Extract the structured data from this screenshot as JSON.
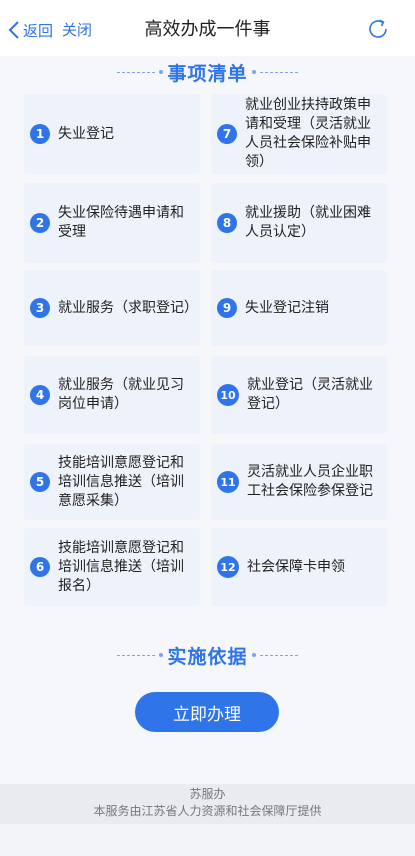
{
  "navbar": {
    "back_label": "返回",
    "close_label": "关闭",
    "title": "高效办成一件事"
  },
  "sections": {
    "items_title": "事项清单",
    "basis_title": "实施依据"
  },
  "items": [
    {
      "num": "1",
      "label": "失业登记"
    },
    {
      "num": "2",
      "label": "失业保险待遇申请和受理"
    },
    {
      "num": "3",
      "label": "就业服务（求职登记）"
    },
    {
      "num": "4",
      "label": "就业服务（就业见习岗位申请）"
    },
    {
      "num": "5",
      "label": "技能培训意愿登记和培训信息推送（培训意愿采集）"
    },
    {
      "num": "6",
      "label": "技能培训意愿登记和培训信息推送（培训报名）"
    },
    {
      "num": "7",
      "label": "就业创业扶持政策申请和受理（灵活就业人员社会保险补贴申领）"
    },
    {
      "num": "8",
      "label": "就业援助（就业困难人员认定）"
    },
    {
      "num": "9",
      "label": "失业登记注销"
    },
    {
      "num": "10",
      "label": "就业登记（灵活就业登记）"
    },
    {
      "num": "11",
      "label": "灵活就业人员企业职工社会保险参保登记"
    },
    {
      "num": "12",
      "label": "社会保障卡申领"
    }
  ],
  "action": {
    "handle_label": "立即办理"
  },
  "footer": {
    "brand": "苏服办",
    "provider": "本服务由江苏省人力资源和社会保障厅提供"
  },
  "colors": {
    "accent": "#2f74e8",
    "card_bg": "#eef2fa"
  },
  "icons": {
    "back": "chevron-left-icon",
    "refresh": "refresh-icon"
  }
}
